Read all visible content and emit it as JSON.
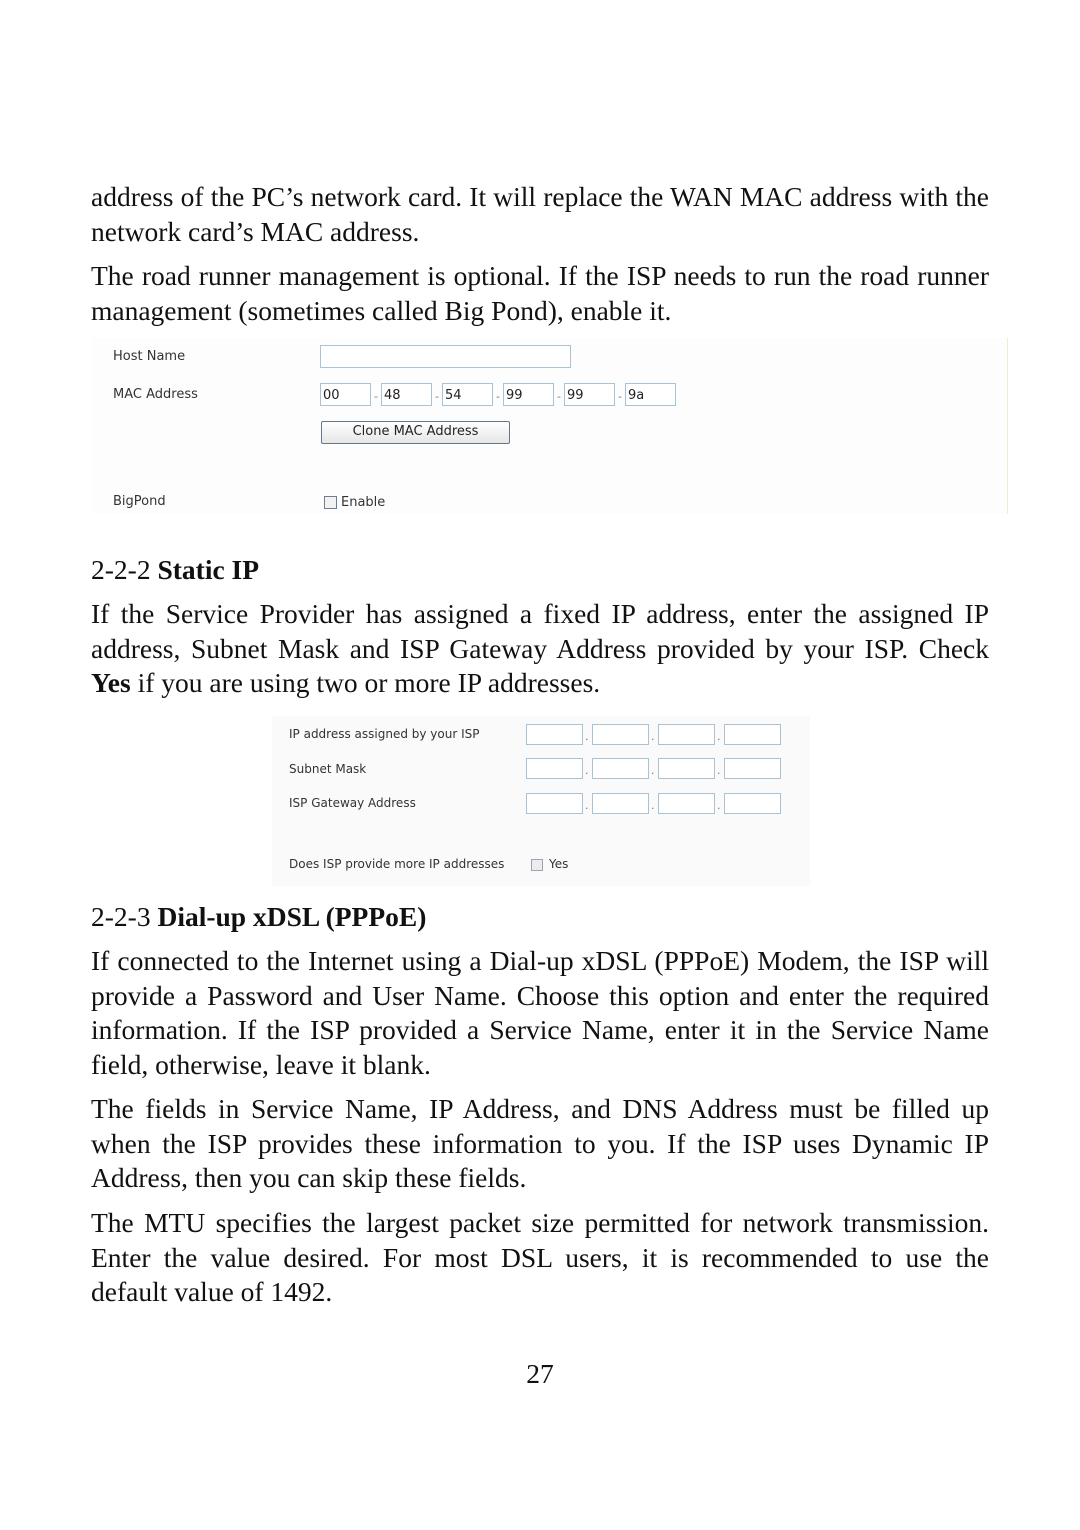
{
  "intro": {
    "para1": "address of the PC’s network card. It will replace the WAN MAC address with the network card’s MAC address.",
    "para2": "The road runner management is optional. If the ISP needs to run the road runner management (sometimes called Big Pond), enable it."
  },
  "dynamic_ip_panel": {
    "host_name_label": "Host Name",
    "host_name_value": "",
    "mac_address_label": "MAC Address",
    "mac_octets": [
      "00",
      "48",
      "54",
      "99",
      "99",
      "9a"
    ],
    "mac_separator": "-",
    "clone_button_label": "Clone MAC Address",
    "bigpond_label": "BigPond",
    "bigpond_checkbox_label": "Enable",
    "bigpond_checked": false
  },
  "static_ip": {
    "section_number": "2-2-2",
    "section_title": "Static IP",
    "para_before_bold": "If the Service Provider has assigned a fixed IP address, enter the assigned IP address, Subnet Mask and ISP Gateway Address provided by your ISP. Check ",
    "para_bold": "Yes",
    "para_after_bold": " if you are using two or more IP addresses."
  },
  "static_ip_panel": {
    "rows": [
      {
        "label": "IP address assigned by your ISP",
        "octets": [
          "",
          "",
          "",
          ""
        ]
      },
      {
        "label": "Subnet Mask",
        "octets": [
          "",
          "",
          "",
          ""
        ]
      },
      {
        "label": "ISP Gateway Address",
        "octets": [
          "",
          "",
          "",
          ""
        ]
      }
    ],
    "octet_separator": ".",
    "more_ip_label": "Does ISP provide more IP addresses",
    "more_ip_checkbox_label": "Yes",
    "more_ip_checked": false
  },
  "pppoe": {
    "section_number": "2-2-3",
    "section_title": "Dial-up xDSL (PPPoE)",
    "para1": "If connected to the Internet using a Dial-up xDSL (PPPoE) Modem, the ISP will provide a Password and User Name. Choose this option and enter the required information. If the ISP provided a Service Name, enter it in the Service Name field, otherwise, leave it blank.",
    "para2": "The fields in Service Name, IP Address, and DNS Address must be filled up when the ISP provides these information to you. If the ISP uses Dynamic IP Address, then you can skip these fields.",
    "para3": "The MTU specifies the largest packet size permitted for network transmission. Enter the value desired. For most DSL users, it is recommended to use the default value of 1492."
  },
  "page_number": "27"
}
